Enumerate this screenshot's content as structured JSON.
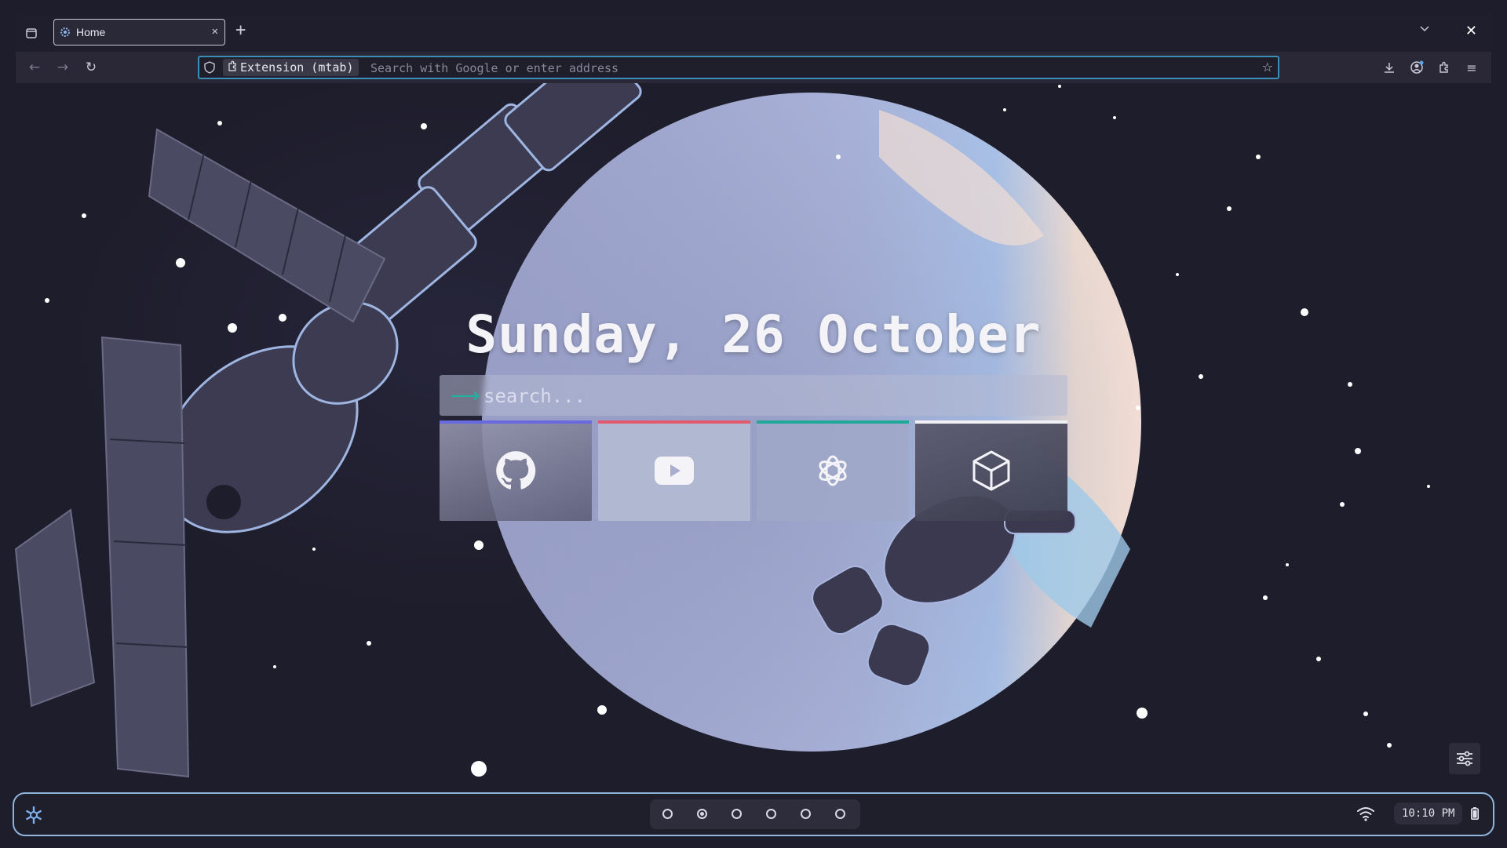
{
  "window": {
    "tab_title": "Home",
    "tab_close_glyph": "✕",
    "new_tab_glyph": "+",
    "tabs_menu_glyph": "⌵",
    "window_close_glyph": "✕"
  },
  "navbar": {
    "back_glyph": "←",
    "forward_glyph": "→",
    "reload_glyph": "↻",
    "extension_label": "Extension (mtab)",
    "address_placeholder": "Search with Google or enter address",
    "bookmark_glyph": "☆",
    "menu_glyph": "≡"
  },
  "newtab": {
    "date_text": "Sunday, 26 October",
    "search_placeholder": "search...",
    "search_arrow_glyph": "⟶",
    "shortcuts": [
      {
        "name": "github",
        "accent": "#6a6ae0"
      },
      {
        "name": "youtube",
        "accent": "#e05a70"
      },
      {
        "name": "chatgpt",
        "accent": "#1fa898"
      },
      {
        "name": "cube",
        "accent": "#f0f0f5"
      }
    ]
  },
  "panel": {
    "workspaces_count": 6,
    "active_workspace": 2,
    "clock_text": "10:10 PM"
  },
  "icons": [
    "tab-list-icon",
    "favicon-icon",
    "close-icon",
    "plus-icon",
    "chevron-down-icon",
    "back-arrow-icon",
    "forward-arrow-icon",
    "reload-icon",
    "shield-icon",
    "puzzle-icon",
    "star-icon",
    "download-icon",
    "account-icon",
    "extensions-icon",
    "menu-icon",
    "arrow-right-icon",
    "github-icon",
    "youtube-icon",
    "openai-icon",
    "cube-icon",
    "sliders-icon",
    "snowflake-logo-icon",
    "wifi-icon",
    "battery-icon"
  ],
  "colors": {
    "background": "#1e1d2b",
    "url_focus_border": "#3b8eb8",
    "panel_border": "#8fb3d9",
    "search_arrow": "#1fb3a0",
    "planet": "#a8b0d8"
  }
}
